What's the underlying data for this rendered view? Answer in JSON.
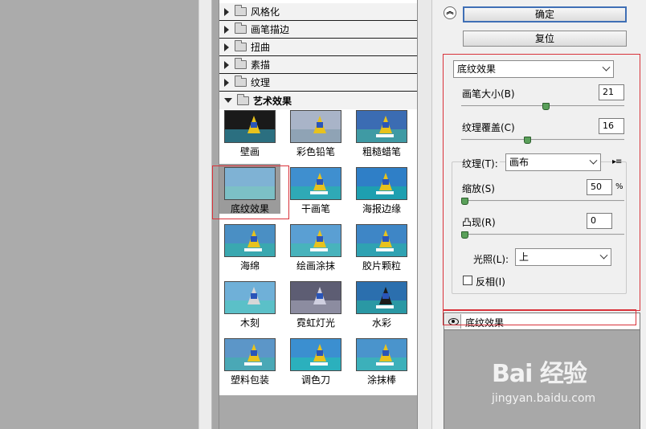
{
  "gallery": {
    "categories": [
      {
        "label": "风格化",
        "expanded": false
      },
      {
        "label": "画笔描边",
        "expanded": false
      },
      {
        "label": "扭曲",
        "expanded": false
      },
      {
        "label": "素描",
        "expanded": false
      },
      {
        "label": "纹理",
        "expanded": false
      },
      {
        "label": "艺术效果",
        "expanded": true
      }
    ],
    "filters": [
      "壁画",
      "彩色铅笔",
      "粗糙蜡笔",
      "底纹效果",
      "干画笔",
      "海报边缘",
      "海绵",
      "绘画涂抹",
      "胶片颗粒",
      "木刻",
      "霓虹灯光",
      "水彩",
      "塑料包装",
      "调色刀",
      "涂抹棒"
    ],
    "selected_filter": "底纹效果"
  },
  "buttons": {
    "ok": "确定",
    "reset": "复位"
  },
  "settings": {
    "filter_select": "底纹效果",
    "brush_size_label": "画笔大小(B)",
    "brush_size_value": "21",
    "brush_size_fraction": 0.52,
    "texture_coverage_label": "纹理覆盖(C)",
    "texture_coverage_value": "16",
    "texture_coverage_fraction": 0.4,
    "texture_label": "纹理(T):",
    "texture_value": "画布",
    "scaling_label": "缩放(S)",
    "scaling_value": "50",
    "scaling_unit": "%",
    "scaling_fraction": 0.0,
    "relief_label": "凸现(R)",
    "relief_value": "0",
    "relief_fraction": 0.0,
    "light_label": "光照(L):",
    "light_value": "上",
    "invert_label": "反相(I)",
    "invert_checked": false
  },
  "layers": {
    "items": [
      "底纹效果"
    ]
  },
  "watermark": {
    "logo": "Bai 经验",
    "url": "jingyan.baidu.com"
  }
}
